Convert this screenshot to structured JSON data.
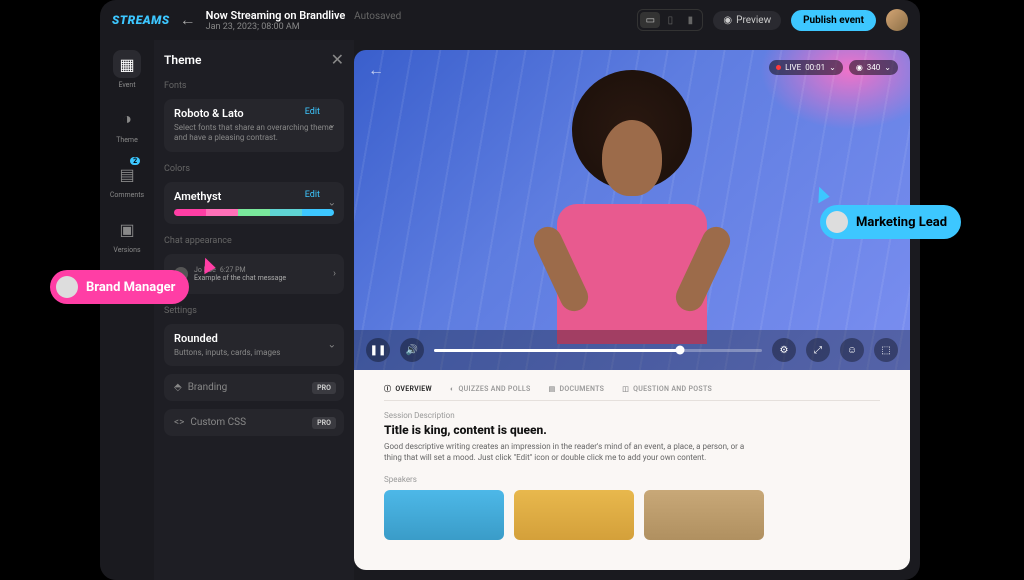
{
  "logo": "STREAMS",
  "header": {
    "title": "Now Streaming on Brandlive",
    "autosaved": "Autosaved",
    "subtitle": "Jan 23, 2023; 08:00 AM",
    "preview": "Preview",
    "publish": "Publish event"
  },
  "rail": {
    "event": "Event",
    "theme": "Theme",
    "comments": "Comments",
    "comments_badge": "2",
    "versions": "Versions"
  },
  "panel": {
    "title": "Theme",
    "fonts_label": "Fonts",
    "fonts_title": "Roboto & Lato",
    "fonts_edit": "Edit",
    "fonts_desc": "Select fonts that share an overarching theme and have a pleasing contrast.",
    "colors_label": "Colors",
    "colors_title": "Amethyst",
    "colors_edit": "Edit",
    "palette": [
      "#ff3ea5",
      "#ff70b8",
      "#7ae89c",
      "#5fd4d4",
      "#3dc7ff"
    ],
    "chat_label": "Chat appearance",
    "chat_name": "Jo Doe",
    "chat_time": "6:27 PM",
    "chat_msg": "Example of the chat message",
    "settings_label": "Settings",
    "rounded_title": "Rounded",
    "rounded_desc": "Buttons, inputs, cards, images",
    "branding": "Branding",
    "custom_css": "Custom CSS",
    "pro": "PRO"
  },
  "video": {
    "live_label": "LIVE",
    "live_time": "00:01",
    "viewers": "340"
  },
  "content": {
    "tabs": {
      "overview": "OVERVIEW",
      "quizzes": "QUIZZES AND POLLS",
      "documents": "DOCUMENTS",
      "qa": "QUESTION AND POSTS"
    },
    "desc_label": "Session Description",
    "title": "Title is king, content is queen.",
    "body": "Good descriptive writing creates an impression in the reader's mind of an event, a place, a person, or a thing that will set a mood. Just click \"Edit\" icon or double click me to add your own content.",
    "speakers_label": "Speakers"
  },
  "cursors": {
    "brand_manager": "Brand Manager",
    "marketing_lead": "Marketing Lead"
  }
}
